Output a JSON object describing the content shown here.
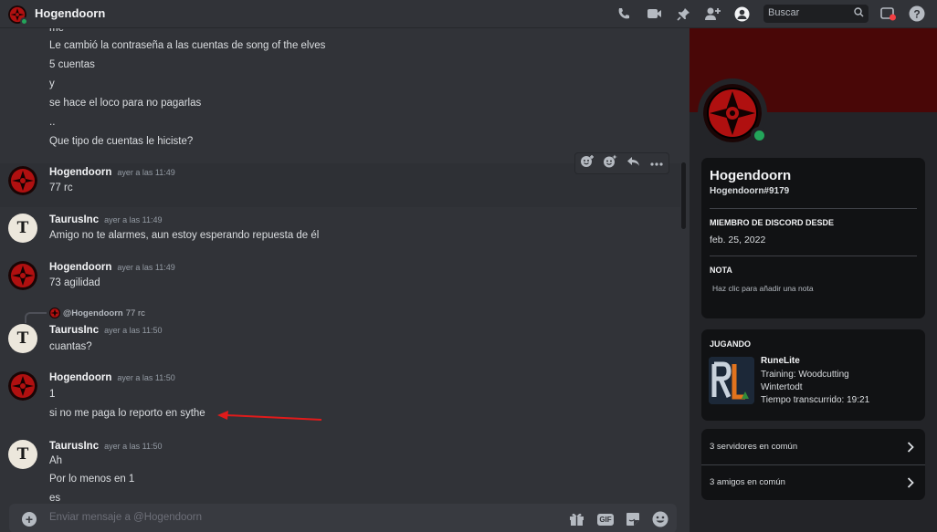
{
  "header": {
    "title": "Hogendoorn",
    "search_placeholder": "Buscar",
    "icons": [
      "call-icon",
      "video-icon",
      "pin-icon",
      "add-friend-icon",
      "profile-icon",
      "search-icon",
      "inbox-icon",
      "help-icon"
    ]
  },
  "chat": {
    "continued_lines": [
      {
        "text": "me"
      },
      {
        "text": "Le cambió la contraseña a las cuentas de song of the elves"
      },
      {
        "text": "5 cuentas"
      },
      {
        "text": "y"
      },
      {
        "text": "se hace el loco para no pagarlas"
      },
      {
        "text": ".."
      },
      {
        "text": "Que tipo de cuentas le hiciste?"
      }
    ],
    "messages": [
      {
        "author": "Hogendoorn",
        "time": "ayer a las 11:49",
        "lines": [
          "77 rc"
        ]
      },
      {
        "author": "TaurusInc",
        "time": "ayer a las 11:49",
        "lines": [
          "Amigo no te alarmes, aun estoy esperando repuesta de él"
        ]
      },
      {
        "author": "Hogendoorn",
        "time": "ayer a las 11:49",
        "lines": [
          "73 agilidad"
        ]
      },
      {
        "author": "TaurusInc",
        "time": "ayer a las 11:50",
        "reply_to": "@Hogendoorn",
        "reply_text": "77 rc",
        "lines": [
          "cuantas?"
        ]
      },
      {
        "author": "Hogendoorn",
        "time": "ayer a las 11:50",
        "lines": [
          "1",
          "si no me paga lo reporto en sythe"
        ]
      },
      {
        "author": "TaurusInc",
        "time": "ayer a las 11:50",
        "lines": [
          "Ah",
          "Por lo menos en 1",
          "es"
        ]
      }
    ],
    "avatar_letter": "T",
    "composer_placeholder": "Enviar mensaje a @Hogendoorn",
    "gif_label": "GIF",
    "arrow_color": "#e01b1b"
  },
  "profile": {
    "name": "Hogendoorn",
    "tag": "Hogendoorn#9179",
    "member_since_label": "MIEMBRO DE DISCORD DESDE",
    "member_since": "feb. 25, 2022",
    "note_label": "NOTA",
    "note_placeholder": "Haz clic para añadir una nota",
    "activity_label": "JUGANDO",
    "game": {
      "name": "RuneLite",
      "details": "Training: Woodcutting",
      "state": "Wintertodt",
      "elapsed": "Tiempo transcurrido: 19:21"
    },
    "mutual_servers": "3 servidores en común",
    "mutual_friends": "3 amigos en común",
    "banner_color": "#490707",
    "status_color": "#23a55a"
  }
}
